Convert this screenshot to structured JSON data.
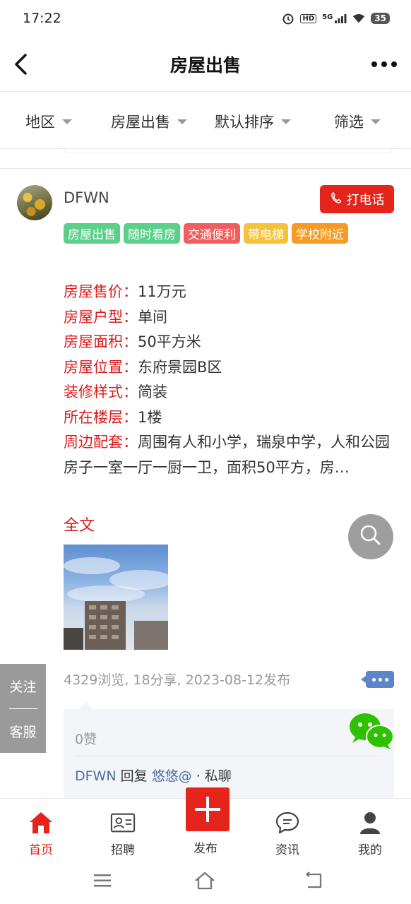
{
  "status_bar": {
    "time": "17:22",
    "network": "5G",
    "hd": "HD",
    "battery": "35"
  },
  "header": {
    "title": "房屋出售"
  },
  "filters": [
    {
      "label": "地区"
    },
    {
      "label": "房屋出售"
    },
    {
      "label": "默认排序"
    },
    {
      "label": "筛选"
    }
  ],
  "post": {
    "username": "DFWN",
    "call_label": "打电话",
    "tags": [
      {
        "text": "房屋出售",
        "color": "#5ccf8b"
      },
      {
        "text": "随时看房",
        "color": "#5ccf8b"
      },
      {
        "text": "交通便利",
        "color": "#ef5f5f"
      },
      {
        "text": "带电梯",
        "color": "#f5c33b"
      },
      {
        "text": "学校附近",
        "color": "#f59a23"
      }
    ],
    "fields": [
      {
        "label": "房屋售价：",
        "value": "11万元"
      },
      {
        "label": "房屋户型：",
        "value": "单间"
      },
      {
        "label": "房屋面积：",
        "value": "50平方米"
      },
      {
        "label": "房屋位置：",
        "value": "东府景园B区"
      },
      {
        "label": "装修样式：",
        "value": "简装"
      },
      {
        "label": "所在楼层：",
        "value": "1楼"
      },
      {
        "label": "周边配套：",
        "value": "周围有人和小学，瑞泉中学，人和公园"
      }
    ],
    "description": "房子一室一厅一厨一卫，面积50平方，房…",
    "full_text_label": "全文",
    "stats": "4329浏览, 18分享, 2023-08-12发布",
    "likes": "0赞",
    "reply": {
      "author": "DFWN",
      "verb": " 回复 ",
      "target": "悠悠@",
      "sep": " · ",
      "action": "私聊"
    }
  },
  "side_tab": {
    "follow": "关注",
    "service": "客服"
  },
  "tab_bar": [
    {
      "label": "首页",
      "icon": "home-icon"
    },
    {
      "label": "招聘",
      "icon": "id-card-icon"
    },
    {
      "label": "发布",
      "icon": "plus-icon"
    },
    {
      "label": "资讯",
      "icon": "chat-icon"
    },
    {
      "label": "我的",
      "icon": "user-icon"
    }
  ],
  "colors": {
    "accent": "#e5241b",
    "label_red": "#d81e1e",
    "link_blue": "#4a6fa5"
  }
}
